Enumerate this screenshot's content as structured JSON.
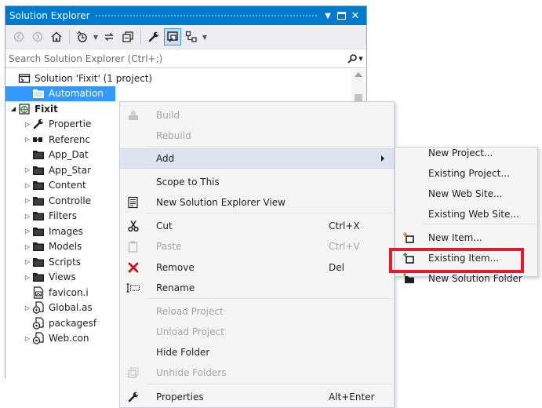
{
  "panel": {
    "title": "Solution Explorer",
    "search_placeholder": "Search Solution Explorer (Ctrl+;)"
  },
  "tree": [
    {
      "label": "Solution 'Fixit' (1 project)",
      "icon": "solution-icon",
      "expander": "",
      "selected": false,
      "bold": false,
      "indent": 0
    },
    {
      "label": "Automation",
      "icon": "folder-icon",
      "expander": "",
      "selected": true,
      "bold": false,
      "indent": 1
    },
    {
      "label": "Fixit",
      "icon": "web-project-icon",
      "expander": "open",
      "selected": false,
      "bold": true,
      "indent": 0
    },
    {
      "label": "Propertie",
      "icon": "wrench-icon",
      "expander": "closed",
      "selected": false,
      "bold": false,
      "indent": 1
    },
    {
      "label": "Referenc",
      "icon": "references-icon",
      "expander": "closed",
      "selected": false,
      "bold": false,
      "indent": 1
    },
    {
      "label": "App_Dat",
      "icon": "folder-icon",
      "expander": "",
      "selected": false,
      "bold": false,
      "indent": 1
    },
    {
      "label": "App_Star",
      "icon": "folder-icon",
      "expander": "closed",
      "selected": false,
      "bold": false,
      "indent": 1
    },
    {
      "label": "Content",
      "icon": "folder-icon",
      "expander": "closed",
      "selected": false,
      "bold": false,
      "indent": 1
    },
    {
      "label": "Controlle",
      "icon": "folder-icon",
      "expander": "closed",
      "selected": false,
      "bold": false,
      "indent": 1
    },
    {
      "label": "Filters",
      "icon": "folder-icon",
      "expander": "closed",
      "selected": false,
      "bold": false,
      "indent": 1
    },
    {
      "label": "Images",
      "icon": "folder-icon",
      "expander": "closed",
      "selected": false,
      "bold": false,
      "indent": 1
    },
    {
      "label": "Models",
      "icon": "folder-icon",
      "expander": "closed",
      "selected": false,
      "bold": false,
      "indent": 1
    },
    {
      "label": "Scripts",
      "icon": "folder-icon",
      "expander": "closed",
      "selected": false,
      "bold": false,
      "indent": 1
    },
    {
      "label": "Views",
      "icon": "folder-icon",
      "expander": "closed",
      "selected": false,
      "bold": false,
      "indent": 1
    },
    {
      "label": "favicon.i",
      "icon": "image-file-icon",
      "expander": "",
      "selected": false,
      "bold": false,
      "indent": 1
    },
    {
      "label": "Global.as",
      "icon": "code-file-icon",
      "expander": "closed",
      "selected": false,
      "bold": false,
      "indent": 1
    },
    {
      "label": "packagesf",
      "icon": "config-file-icon",
      "expander": "",
      "selected": false,
      "bold": false,
      "indent": 1
    },
    {
      "label": "Web.con",
      "icon": "config-file-icon",
      "expander": "closed",
      "selected": false,
      "bold": false,
      "indent": 1
    }
  ],
  "context_menu": {
    "items": [
      {
        "label": "Build",
        "shortcut": "",
        "icon": "build-icon",
        "disabled": true,
        "submenu": false,
        "highlighted": false
      },
      {
        "label": "Rebuild",
        "shortcut": "",
        "icon": "",
        "disabled": true,
        "submenu": false,
        "highlighted": false
      },
      {
        "label": "Add",
        "shortcut": "",
        "icon": "",
        "disabled": false,
        "submenu": true,
        "highlighted": true
      },
      {
        "label": "Scope to This",
        "shortcut": "",
        "icon": "",
        "disabled": false,
        "submenu": false,
        "highlighted": false
      },
      {
        "label": "New Solution Explorer View",
        "shortcut": "",
        "icon": "new-view-icon",
        "disabled": false,
        "submenu": false,
        "highlighted": false
      },
      {
        "label": "Cut",
        "shortcut": "Ctrl+X",
        "icon": "scissors-icon",
        "disabled": false,
        "submenu": false,
        "highlighted": false
      },
      {
        "label": "Paste",
        "shortcut": "Ctrl+V",
        "icon": "paste-icon",
        "disabled": true,
        "submenu": false,
        "highlighted": false
      },
      {
        "label": "Remove",
        "shortcut": "Del",
        "icon": "remove-icon",
        "disabled": false,
        "submenu": false,
        "highlighted": false
      },
      {
        "label": "Rename",
        "shortcut": "",
        "icon": "rename-icon",
        "disabled": false,
        "submenu": false,
        "highlighted": false
      },
      {
        "label": "Reload Project",
        "shortcut": "",
        "icon": "",
        "disabled": true,
        "submenu": false,
        "highlighted": false
      },
      {
        "label": "Unload Project",
        "shortcut": "",
        "icon": "",
        "disabled": true,
        "submenu": false,
        "highlighted": false
      },
      {
        "label": "Hide Folder",
        "shortcut": "",
        "icon": "",
        "disabled": false,
        "submenu": false,
        "highlighted": false
      },
      {
        "label": "Unhide Folders",
        "shortcut": "",
        "icon": "unhide-icon",
        "disabled": true,
        "submenu": false,
        "highlighted": false
      },
      {
        "label": "Properties",
        "shortcut": "Alt+Enter",
        "icon": "wrench-icon",
        "disabled": false,
        "submenu": false,
        "highlighted": false
      }
    ]
  },
  "add_submenu": {
    "items": [
      {
        "label": "New Project...",
        "icon": ""
      },
      {
        "label": "Existing Project...",
        "icon": ""
      },
      {
        "label": "New Web Site...",
        "icon": ""
      },
      {
        "label": "Existing Web Site...",
        "icon": ""
      },
      {
        "label": "New Item...",
        "icon": "new-item-icon"
      },
      {
        "label": "Existing Item...",
        "icon": "existing-item-icon"
      },
      {
        "label": "New Solution Folder",
        "icon": "new-folder-icon"
      }
    ]
  },
  "colors": {
    "accent": "#007acc",
    "selection": "#3399ff",
    "highlight_box": "#e8192c"
  }
}
